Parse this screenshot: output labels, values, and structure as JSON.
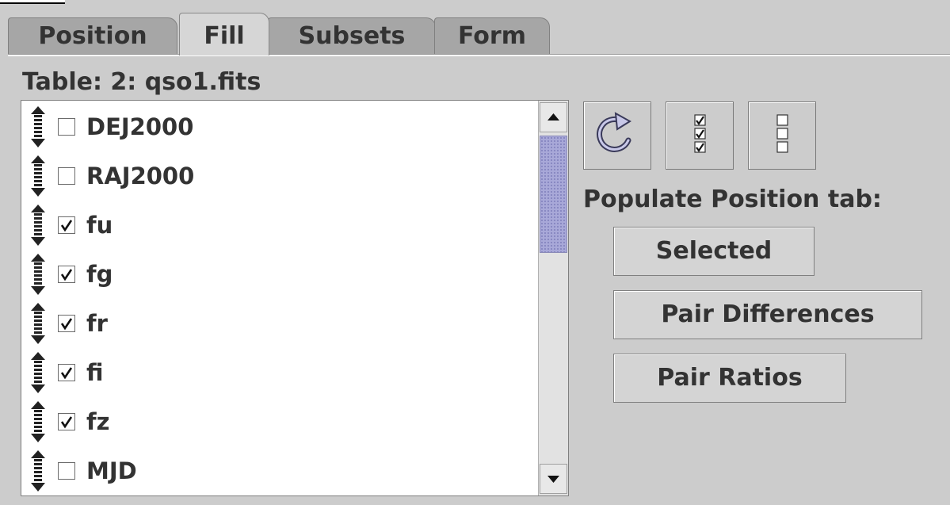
{
  "tabs": [
    {
      "label": "Position",
      "active": false
    },
    {
      "label": "Fill",
      "active": true
    },
    {
      "label": "Subsets",
      "active": false
    },
    {
      "label": "Form",
      "active": false
    }
  ],
  "table_label": "Table: 2: qso1.fits",
  "columns": [
    {
      "name": "DEJ2000",
      "checked": false
    },
    {
      "name": "RAJ2000",
      "checked": false
    },
    {
      "name": "fu",
      "checked": true
    },
    {
      "name": "fg",
      "checked": true
    },
    {
      "name": "fr",
      "checked": true
    },
    {
      "name": "fi",
      "checked": true
    },
    {
      "name": "fz",
      "checked": true
    },
    {
      "name": "MJD",
      "checked": false
    }
  ],
  "toolbar": {
    "refresh_icon": "refresh-icon",
    "select_all_icon": "check-all-icon",
    "select_none_icon": "uncheck-all-icon"
  },
  "populate": {
    "label": "Populate Position tab:",
    "selected_label": "Selected",
    "pair_differences_label": "Pair Differences",
    "pair_ratios_label": "Pair Ratios"
  },
  "colors": {
    "background": "#cccccc",
    "scroll_thumb": "#a8a8d8",
    "list_background": "#ffffff"
  }
}
